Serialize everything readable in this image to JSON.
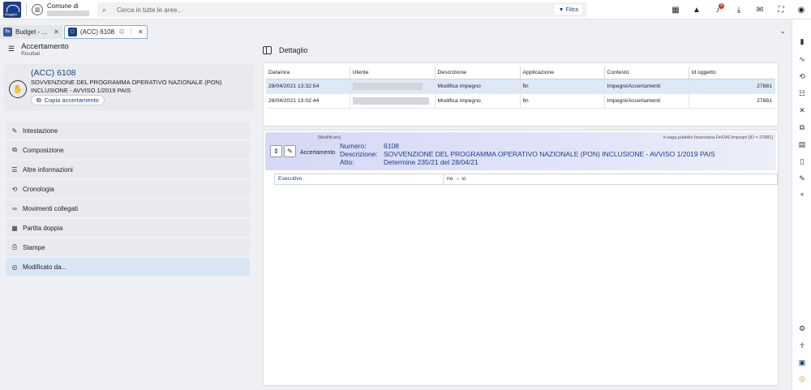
{
  "header": {
    "logo_text": "Maggioli",
    "comune_label": "Comune di",
    "search_placeholder": "Cerca in tutte le aree...",
    "filter_label": "Filtra",
    "notifications_count": "9"
  },
  "tabs": [
    {
      "label": "Budget - ...",
      "icon": "Bu"
    },
    {
      "label": "(ACC) 6108",
      "icon": "▢"
    }
  ],
  "left": {
    "title": "Accertamento",
    "subtitle": "Risultati",
    "card": {
      "code": "(ACC) 6108",
      "line1": "SOVVENZIONE DEL PROGRAMMA OPERATIVO NAZIONALE (PON)",
      "line2": "INCLUSIONE - AVVISO 1/2019 PAIS",
      "copy_button": "Copia accertamento"
    },
    "nav": [
      {
        "label": "Intestazione",
        "icon": "✎"
      },
      {
        "label": "Composizione",
        "icon": "⧉"
      },
      {
        "label": "Altre informazioni",
        "icon": "☰"
      },
      {
        "label": "Cronologia",
        "icon": "⟲"
      },
      {
        "label": "Movimenti collegati",
        "icon": "∞"
      },
      {
        "label": "Partita doppia",
        "icon": "▦"
      },
      {
        "label": "Stampe",
        "icon": "⎙"
      },
      {
        "label": "Modificato da...",
        "icon": "◎"
      }
    ]
  },
  "detail": {
    "title": "Dettaglio",
    "columns": [
      "Data/ora",
      "Utente",
      "Descrizione",
      "Applicazione",
      "Contesto",
      "Id oggetto"
    ],
    "rows": [
      {
        "data": "28/04/2021 13:32:54",
        "descrizione": "Modifica impegno",
        "applicazione": "fin",
        "contesto": "Impegni/Accertamenti",
        "id": "27881"
      },
      {
        "data": "28/04/2021 13:02:44",
        "descrizione": "Modifica impegno",
        "applicazione": "fin",
        "contesto": "Impegni/Accertamenti",
        "id": "27881"
      }
    ],
    "banner": {
      "modified_tag": "[Modificato]",
      "class_ref": "it.saga.pubblici.finanziaria.FinDACImpegni [ID = 27881]",
      "type": "Accertamento",
      "numero_label": "Numero:",
      "numero": "6108",
      "descrizione_label": "Descrizione:",
      "descrizione": "SOVVENZIONE DEL PROGRAMMA OPERATIVO NAZIONALE (PON) INCLUSIONE - AVVISO 1/2019 PAIS",
      "atto_label": "Atto:",
      "atto": "Determine 235/21 del 28/04/21"
    },
    "change": {
      "field": "Esecutivo",
      "value": "no → si"
    }
  },
  "colors": {
    "accent": "#1c3e8a",
    "selected": "#d8e6f6",
    "banner": "#d5d9f6"
  }
}
